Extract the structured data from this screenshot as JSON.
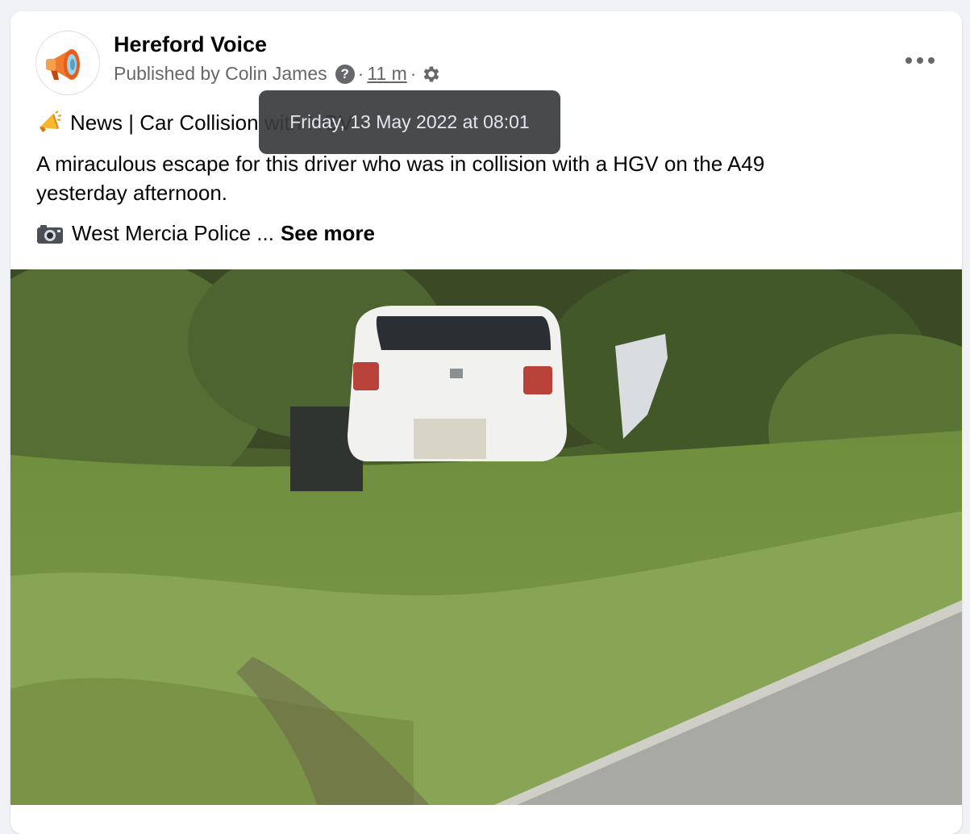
{
  "post": {
    "page_name": "Hereford Voice",
    "published_by": "Published by Colin James",
    "help_symbol": "?",
    "separator": "·",
    "time_ago": "11 m",
    "headline_emoji": "megaphone-icon",
    "headline": "News | Car Collision with HGV",
    "body_text": "A miraculous escape for this driver who was in collision with a HGV on the A49 yesterday afternoon.",
    "body_line1": "A miraculous escape for this driver who was in collision with a HGV on the A49",
    "body_line2": "yesterday afternoon.",
    "credit_emoji": "camera-icon",
    "credit_text": "West Mercia Police ...",
    "see_more": "See more"
  },
  "tooltip": {
    "text": "Friday, 13 May 2022 at 08:01"
  },
  "colors": {
    "primary_text": "#050505",
    "secondary_text": "#65676b",
    "tooltip_bg": "#3a3b3c"
  }
}
